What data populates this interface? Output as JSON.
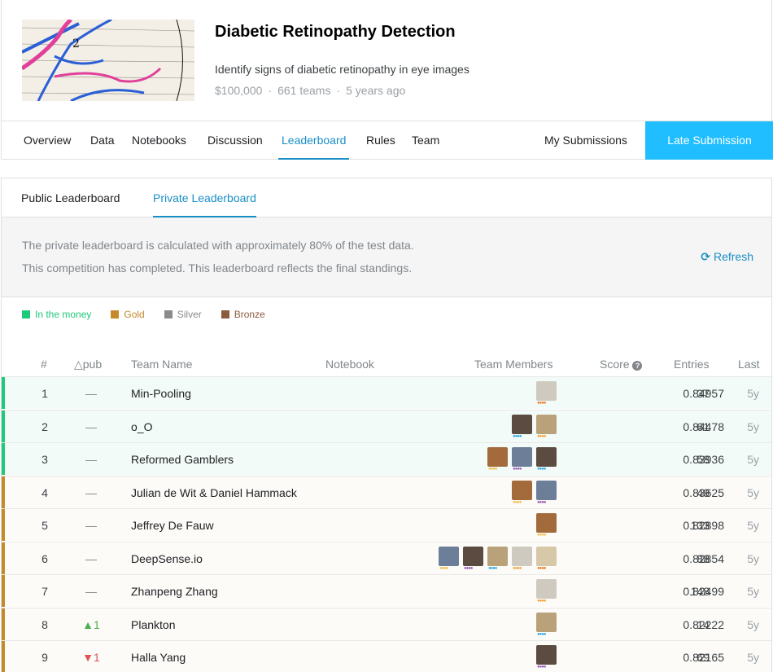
{
  "competition": {
    "title": "Diabetic Retinopathy Detection",
    "description": "Identify signs of diabetic retinopathy in eye images",
    "prize": "$100,000",
    "teams": "661 teams",
    "age": "5 years ago"
  },
  "nav": {
    "tabs": [
      "Overview",
      "Data",
      "Notebooks",
      "Discussion",
      "Leaderboard",
      "Rules",
      "Team"
    ],
    "active": "Leaderboard",
    "my_submissions": "My Submissions",
    "late_submission": "Late Submission"
  },
  "leaderboard": {
    "tabs": [
      "Public Leaderboard",
      "Private Leaderboard"
    ],
    "active_tab": "Private Leaderboard",
    "info_line1": "The private leaderboard is calculated with approximately 80% of the test data.",
    "info_line2": "This competition has completed. This leaderboard reflects the final standings.",
    "refresh": "Refresh",
    "legend": [
      {
        "label": "In the money",
        "color": "#20c97a"
      },
      {
        "label": "Gold",
        "color": "#c48a2c"
      },
      {
        "label": "Silver",
        "color": "#8a8a8a"
      },
      {
        "label": "Bronze",
        "color": "#8c5a3c"
      }
    ],
    "headers": {
      "rank": "#",
      "delta": "△pub",
      "team": "Team Name",
      "notebook": "Notebook",
      "members": "Team Members",
      "score": "Score",
      "entries": "Entries",
      "last": "Last"
    },
    "rows": [
      {
        "rank": "1",
        "delta": "—",
        "team": "Min-Pooling",
        "score": "0.84957",
        "entries": "37",
        "last": "5y",
        "tier": "money",
        "members": 1
      },
      {
        "rank": "2",
        "delta": "—",
        "team": "o_O",
        "score": "0.84478",
        "entries": "61",
        "last": "5y",
        "tier": "money",
        "members": 2
      },
      {
        "rank": "3",
        "delta": "—",
        "team": "Reformed Gamblers",
        "score": "0.83936",
        "entries": "58",
        "last": "5y",
        "tier": "money",
        "members": 3
      },
      {
        "rank": "4",
        "delta": "—",
        "team": "Julian de Wit & Daniel Hammack",
        "score": "0.83625",
        "entries": "49",
        "last": "5y",
        "tier": "gold",
        "members": 2
      },
      {
        "rank": "5",
        "delta": "—",
        "team": "Jeffrey De Fauw",
        "score": "0.82898",
        "entries": "133",
        "last": "5y",
        "tier": "gold",
        "members": 1
      },
      {
        "rank": "6",
        "delta": "—",
        "team": "DeepSense.io",
        "score": "0.82854",
        "entries": "88",
        "last": "5y",
        "tier": "gold",
        "members": 5
      },
      {
        "rank": "7",
        "delta": "—",
        "team": "Zhanpeng Zhang",
        "score": "0.82499",
        "entries": "148",
        "last": "5y",
        "tier": "gold",
        "members": 1
      },
      {
        "rank": "8",
        "delta": "▲1",
        "team": "Plankton",
        "score": "0.82222",
        "entries": "14",
        "last": "5y",
        "tier": "gold",
        "members": 1
      },
      {
        "rank": "9",
        "delta": "▼1",
        "team": "Halla Yang",
        "score": "0.82165",
        "entries": "69",
        "last": "5y",
        "tier": "gold",
        "members": 1
      }
    ]
  }
}
